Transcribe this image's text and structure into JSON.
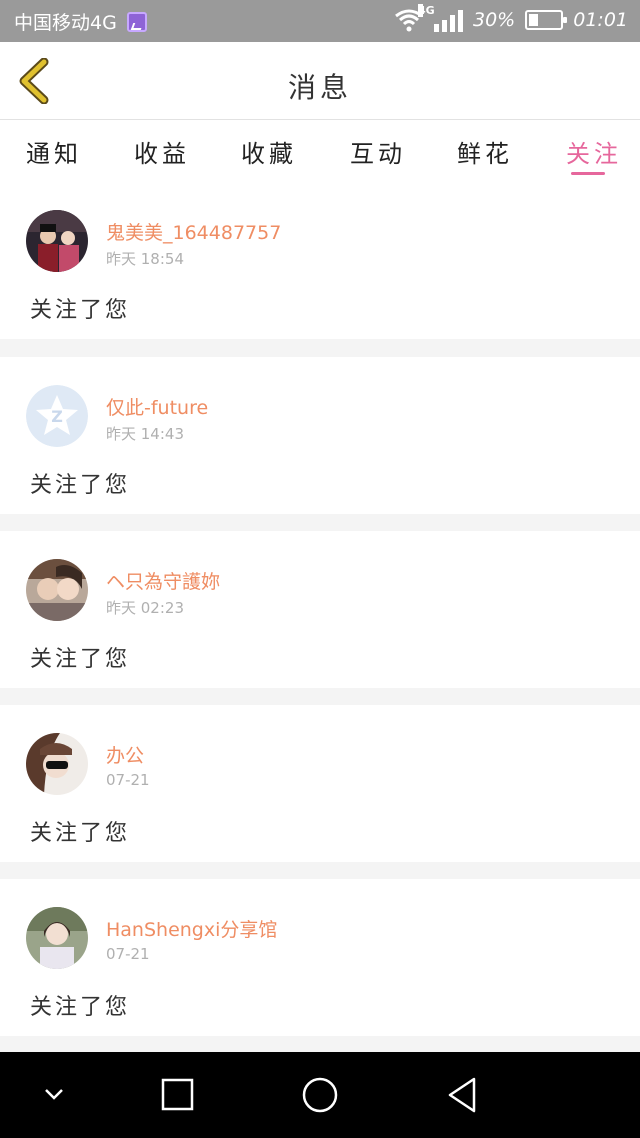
{
  "status_bar": {
    "carrier": "中国移动4G",
    "network": "4G",
    "battery_pct": "30%",
    "battery_level": 0.3,
    "time": "01:01",
    "colors": {
      "background": "#9a9a9a",
      "badge": "#8e63d6"
    }
  },
  "header": {
    "title": "消息",
    "back_icon": "chevron-left-icon"
  },
  "tabs": [
    {
      "label": "通知"
    },
    {
      "label": "收益"
    },
    {
      "label": "收藏"
    },
    {
      "label": "互动"
    },
    {
      "label": "鲜花"
    },
    {
      "label": "关注",
      "active": true
    }
  ],
  "messages": [
    {
      "name": "鬼美美_164487757",
      "time": "昨天 18:54",
      "text": "关注了您"
    },
    {
      "name": "仅此-future",
      "time": "昨天 14:43",
      "text": "关注了您"
    },
    {
      "name": "ヘ只為守護妳",
      "time": "昨天 02:23",
      "text": "关注了您"
    },
    {
      "name": "办公",
      "time": "07-21",
      "text": "关注了您"
    },
    {
      "name": "HanShengxi分享馆",
      "time": "07-21",
      "text": "关注了您"
    }
  ],
  "nav_bar": {
    "icons": [
      "chevron-down-icon",
      "square-icon",
      "circle-icon",
      "triangle-back-icon"
    ]
  },
  "colors": {
    "accent": "#e6679c",
    "name": "#ef8d63",
    "time": "#b0b0b0",
    "back_arrow": "#e0c12f"
  }
}
